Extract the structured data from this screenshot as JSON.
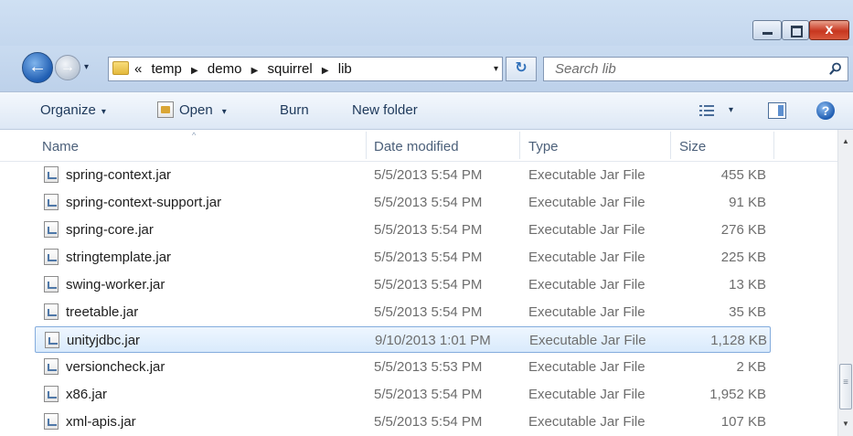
{
  "window": {
    "controls": {
      "minimize": "minimize",
      "maximize": "maximize",
      "close": "x"
    }
  },
  "nav": {
    "back_glyph": "←",
    "forward_glyph": "→",
    "history_glyph": "▾",
    "address": {
      "overflow": "«",
      "crumbs": [
        "temp",
        "demo",
        "squirrel",
        "lib"
      ],
      "separator": "▶",
      "dropdown_glyph": "▾"
    },
    "refresh_glyph": "↻",
    "search": {
      "placeholder": "Search lib"
    }
  },
  "commandbar": {
    "organize": "Organize",
    "open": "Open",
    "burn": "Burn",
    "new_folder": "New folder",
    "dropdown_glyph": "▾",
    "help_glyph": "?"
  },
  "columns": {
    "name": "Name",
    "date": "Date modified",
    "type": "Type",
    "size": "Size",
    "sort_glyph": "^"
  },
  "files": [
    {
      "name": "spring-context.jar",
      "date": "5/5/2013 5:54 PM",
      "type": "Executable Jar File",
      "size": "455 KB",
      "selected": false
    },
    {
      "name": "spring-context-support.jar",
      "date": "5/5/2013 5:54 PM",
      "type": "Executable Jar File",
      "size": "91 KB",
      "selected": false
    },
    {
      "name": "spring-core.jar",
      "date": "5/5/2013 5:54 PM",
      "type": "Executable Jar File",
      "size": "276 KB",
      "selected": false
    },
    {
      "name": "stringtemplate.jar",
      "date": "5/5/2013 5:54 PM",
      "type": "Executable Jar File",
      "size": "225 KB",
      "selected": false
    },
    {
      "name": "swing-worker.jar",
      "date": "5/5/2013 5:54 PM",
      "type": "Executable Jar File",
      "size": "13 KB",
      "selected": false
    },
    {
      "name": "treetable.jar",
      "date": "5/5/2013 5:54 PM",
      "type": "Executable Jar File",
      "size": "35 KB",
      "selected": false
    },
    {
      "name": "unityjdbc.jar",
      "date": "9/10/2013 1:01 PM",
      "type": "Executable Jar File",
      "size": "1,128 KB",
      "selected": true
    },
    {
      "name": "versioncheck.jar",
      "date": "5/5/2013 5:53 PM",
      "type": "Executable Jar File",
      "size": "2 KB",
      "selected": false
    },
    {
      "name": "x86.jar",
      "date": "5/5/2013 5:54 PM",
      "type": "Executable Jar File",
      "size": "1,952 KB",
      "selected": false
    },
    {
      "name": "xml-apis.jar",
      "date": "5/5/2013 5:54 PM",
      "type": "Executable Jar File",
      "size": "107 KB",
      "selected": false
    }
  ],
  "scrollbar": {
    "up_glyph": "▲",
    "down_glyph": "▼"
  },
  "colors": {
    "selection_bg": "#d9eafc",
    "selection_border": "#84acdd",
    "command_text": "#1e395b",
    "header_text": "#4c607a"
  }
}
